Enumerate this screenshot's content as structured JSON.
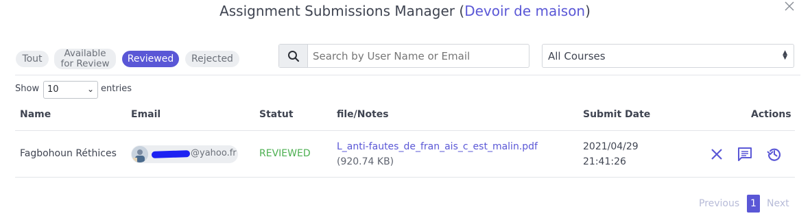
{
  "modal": {
    "title_prefix": "Assignment Submissions Manager (",
    "title_accent": "Devoir de maison",
    "title_suffix": ")",
    "close_icon": "close-icon"
  },
  "filters": {
    "tabs": [
      {
        "label": "Tout",
        "active": false
      },
      {
        "label": "Available for Review",
        "line1": "Available",
        "line2": "for Review",
        "active": false
      },
      {
        "label": "Reviewed",
        "active": true
      },
      {
        "label": "Rejected",
        "active": false
      }
    ],
    "search": {
      "placeholder": "Search by User Name or Email",
      "icon": "search-icon"
    },
    "course_select": {
      "value": "All Courses"
    }
  },
  "length": {
    "show_label": "Show",
    "value": "10",
    "entries_label": "entries"
  },
  "table": {
    "columns": [
      "Name",
      "Email",
      "Statut",
      "file/Notes",
      "Submit Date",
      "Actions"
    ],
    "rows": [
      {
        "name": "Fagbohoun Réthices",
        "email_domain": "@yahoo.fr",
        "status": "REVIEWED",
        "file_name": "L_anti-fautes_de_fran_ais_c_est_malin.pdf",
        "file_size": "(920.74 KB)",
        "date": "2021/04/29",
        "time": "21:41:26",
        "actions": [
          "reject-icon",
          "comment-icon",
          "history-icon"
        ]
      }
    ]
  },
  "pagination": {
    "previous": "Previous",
    "page": "1",
    "next": "Next"
  },
  "colors": {
    "accent": "#5a57d6",
    "status_reviewed": "#4caf50",
    "pill_bg": "#eceef1"
  }
}
